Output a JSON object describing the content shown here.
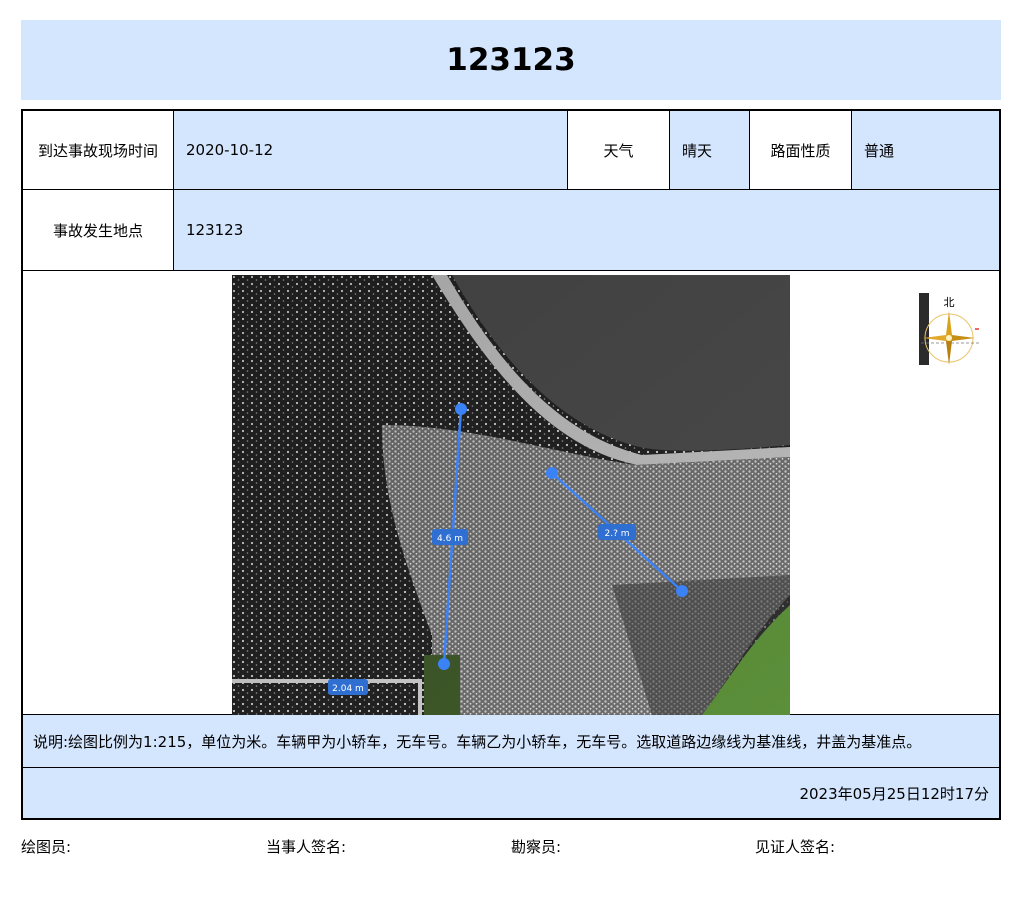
{
  "title": "123123",
  "info": {
    "arrival_time_label": "到达事故现场时间",
    "arrival_time_value": "2020-10-12",
    "weather_label": "天气",
    "weather_value": "晴天",
    "road_surface_label": "路面性质",
    "road_surface_value": "普通",
    "location_label": "事故发生地点",
    "location_value": "123123"
  },
  "diagram": {
    "measurements": [
      "4.6 m",
      "2.? m",
      "2.04 m"
    ],
    "compass_label": "北"
  },
  "note": "说明:绘图比例为1:215，单位为米。车辆甲为小轿车，无车号。车辆乙为小轿车，无车号。选取道路边缘线为基准线，井盖为基准点。",
  "timestamp": "2023年05月25日12时17分",
  "signatures": {
    "drafter": "绘图员:",
    "party": "当事人签名:",
    "surveyor": "勘察员:",
    "witness": "见证人签名:"
  },
  "colors": {
    "header_bg": "#d4e6fe",
    "measure_line": "#3b82f6"
  }
}
